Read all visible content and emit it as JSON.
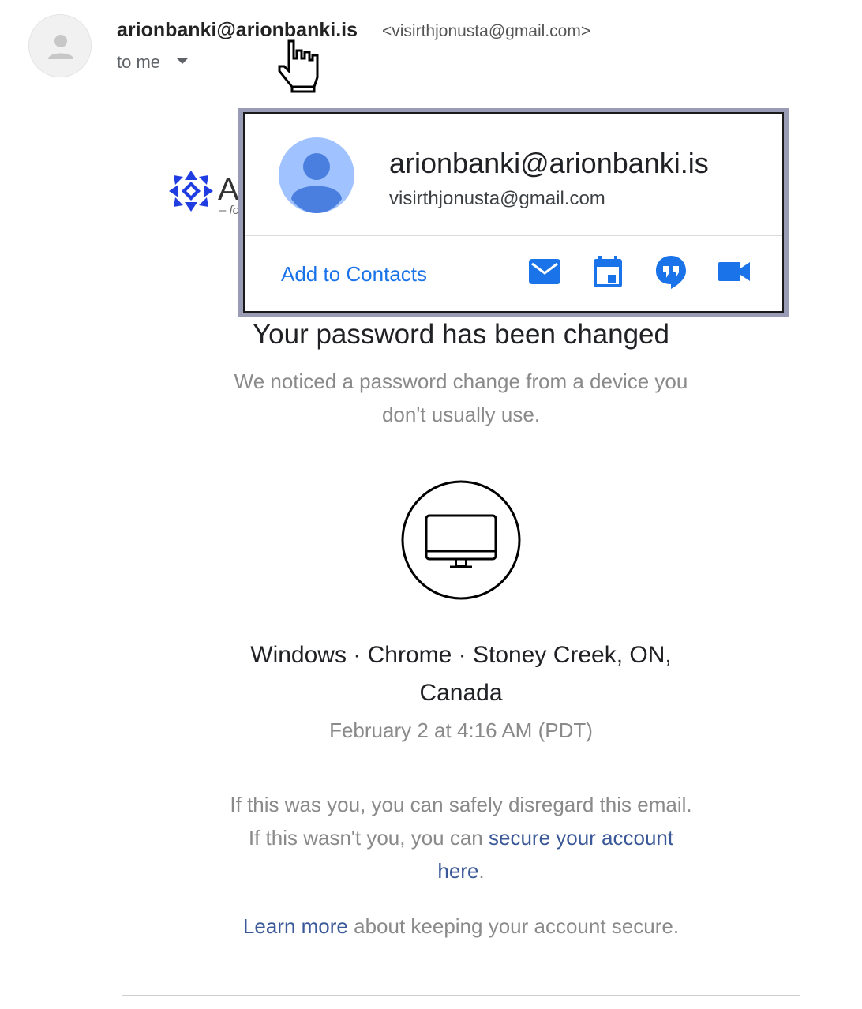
{
  "header": {
    "sender_name": "arionbanki@arionbanki.is",
    "sender_address": "<visirthjonusta@gmail.com>",
    "recipient_label": "to me"
  },
  "brand": {
    "visible_text": "Ar",
    "tagline_fragment": "– for"
  },
  "contact_card": {
    "name": "arionbanki@arionbanki.is",
    "email": "visirthjonusta@gmail.com",
    "add_contacts_label": "Add to Contacts",
    "actions": [
      "mail-icon",
      "calendar-icon",
      "hangouts-icon",
      "video-call-icon"
    ],
    "action_color": "#1a73e8"
  },
  "body": {
    "headline": "Your password has been changed",
    "subtext": "We noticed a password change from a device you don't usually use.",
    "device_icon": "desktop-monitor-icon",
    "device_info_line1": "Windows · Chrome · Stoney Creek, ON,",
    "device_info_line2": "Canada",
    "timestamp": "February 2 at 4:16 AM (PDT)",
    "notice_prefix": "If this was you, you can safely disregard this email. If this wasn't you, you can ",
    "notice_link": "secure your account here",
    "notice_suffix": ".",
    "learn_link": "Learn more",
    "learn_suffix": " about keeping your account secure."
  }
}
